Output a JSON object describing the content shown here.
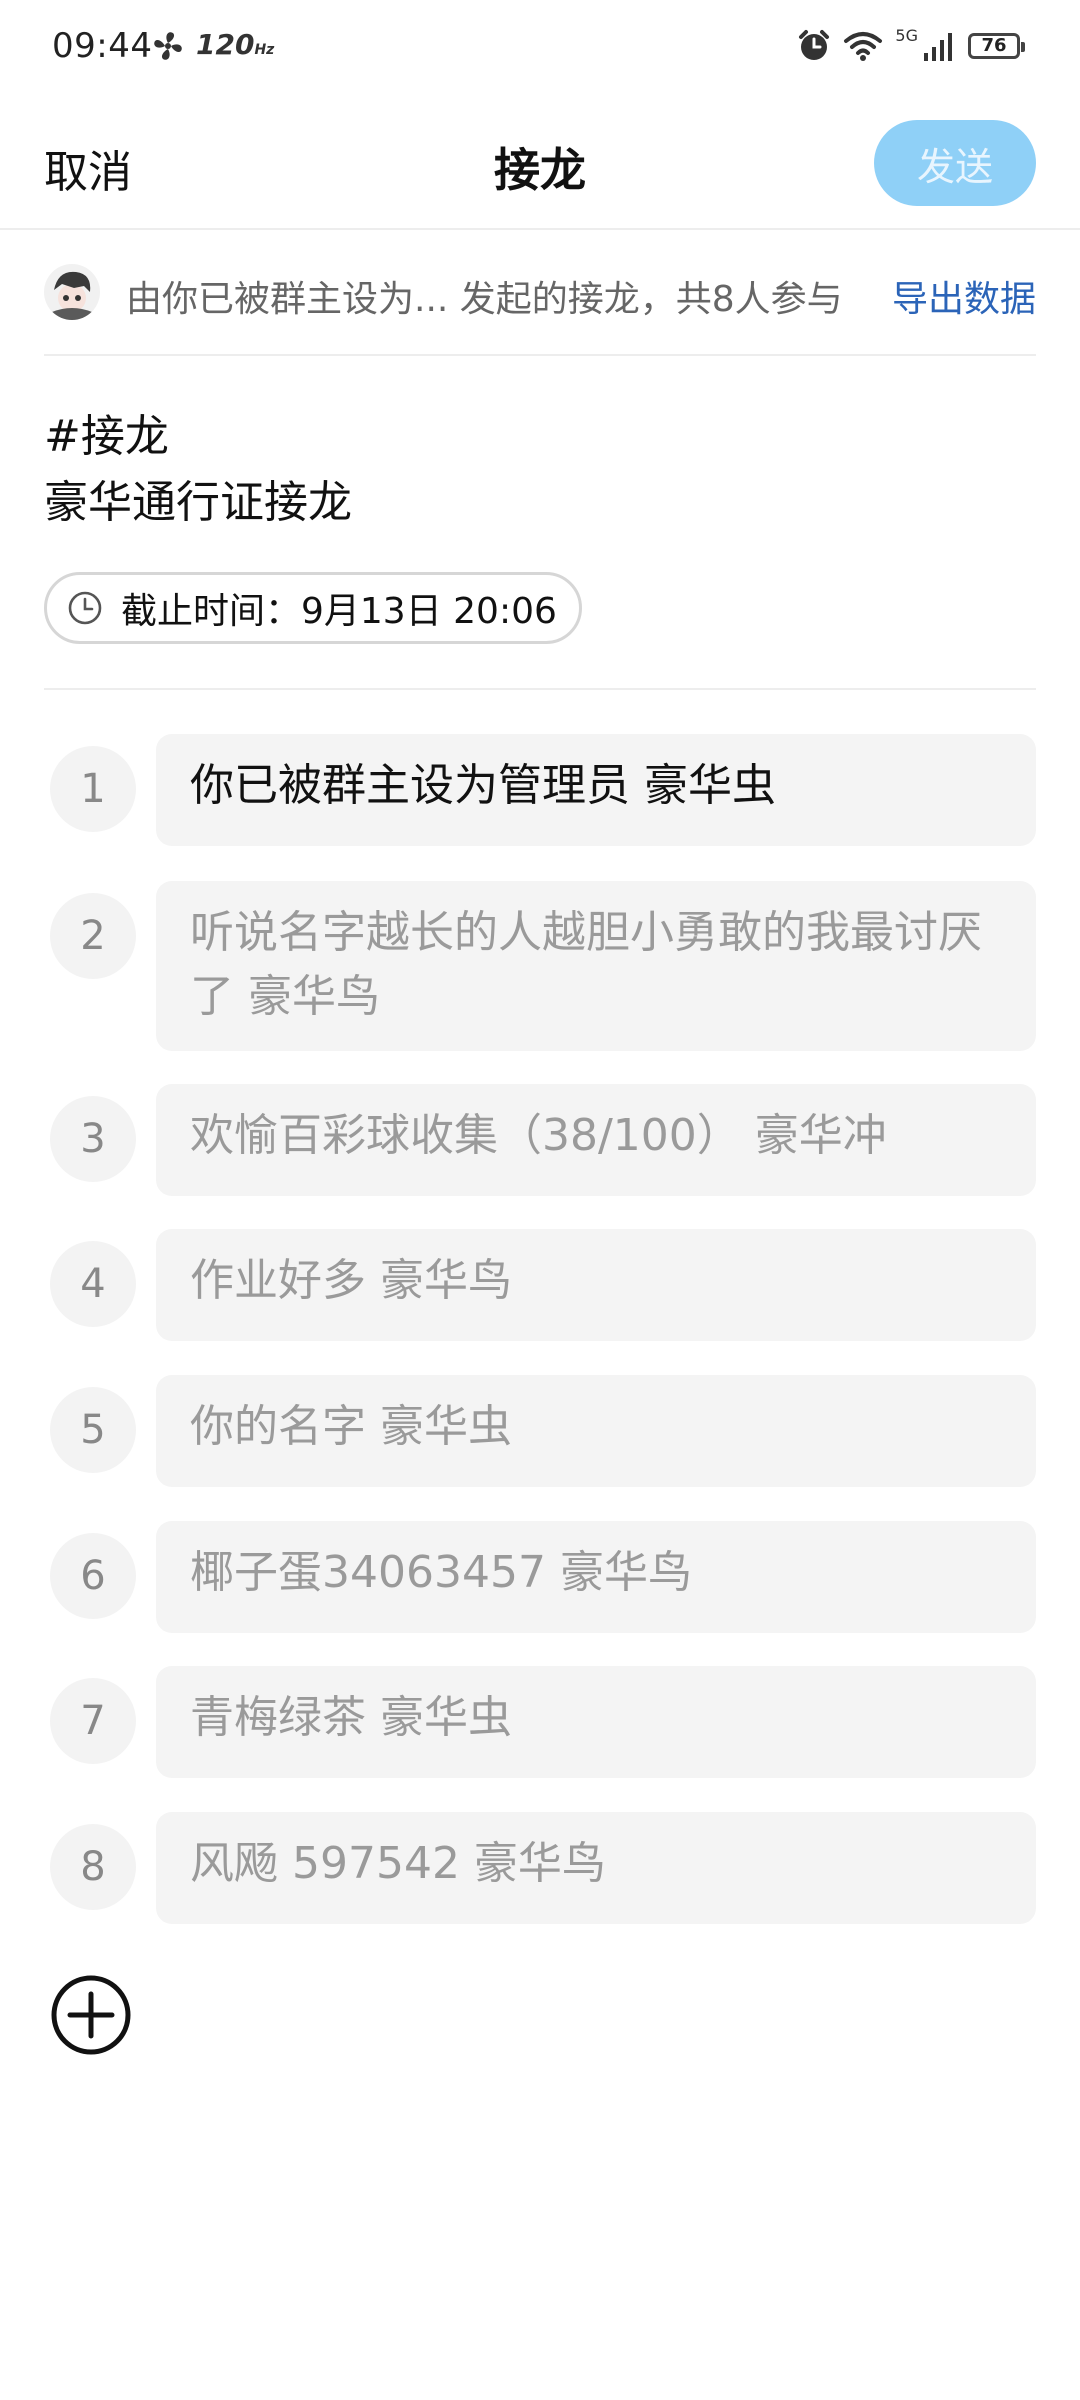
{
  "status_bar": {
    "time": "09:44",
    "refresh_rate": "120",
    "network": "5G",
    "battery": "76"
  },
  "header": {
    "cancel_label": "取消",
    "title": "接龙",
    "send_label": "发送"
  },
  "info": {
    "text": "由你已被群主设为... 发起的接龙，共8人参与",
    "export_label": "导出数据"
  },
  "topic": {
    "line1": "#接龙",
    "line2": "豪华通行证接龙"
  },
  "deadline": {
    "text": "截止时间：9月13日 20:06"
  },
  "entries": [
    {
      "num": "1",
      "text": "你已被群主设为管理员 豪华虫"
    },
    {
      "num": "2",
      "text": "听说名字越长的人越胆小勇敢的我最讨厌了 豪华鸟"
    },
    {
      "num": "3",
      "text": "欢愉百彩球收集（38/100） 豪华冲"
    },
    {
      "num": "4",
      "text": "作业好多 豪华鸟"
    },
    {
      "num": "5",
      "text": "你的名字 豪华虫"
    },
    {
      "num": "6",
      "text": "椰子蛋34063457 豪华鸟"
    },
    {
      "num": "7",
      "text": "青梅绿茶 豪华虫"
    },
    {
      "num": "8",
      "text": "风飏 597542 豪华鸟"
    }
  ],
  "colors": {
    "send_button_bg": "#8fd0f7",
    "export_link": "#2b64b8",
    "entry_bg": "#f4f4f4"
  }
}
